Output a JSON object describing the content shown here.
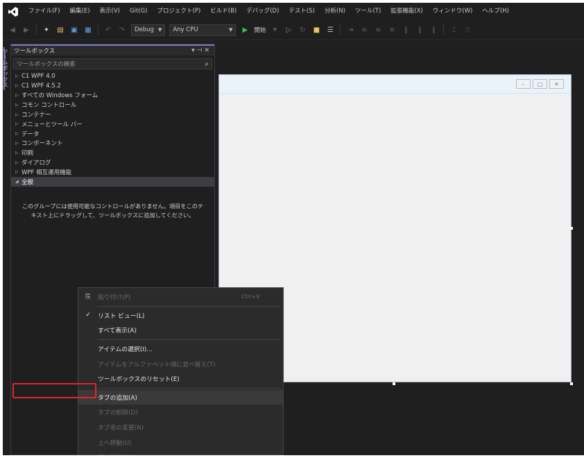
{
  "menubar": {
    "items": [
      "ファイル(F)",
      "編集(E)",
      "表示(V)",
      "Git(G)",
      "プロジェクト(P)",
      "ビルド(B)",
      "デバッグ(D)",
      "テスト(S)",
      "分析(N)",
      "ツール(T)",
      "拡張機能(X)",
      "ウィンドウ(W)",
      "ヘルプ(H)"
    ]
  },
  "toolbar": {
    "config": "Debug",
    "platform": "Any CPU",
    "run_label": "開始"
  },
  "side_tab": {
    "label": "ツールボックス"
  },
  "toolbox": {
    "title": "ツールボックス",
    "search_placeholder": "ツールボックスの検索",
    "groups": [
      {
        "label": "C1 WPF 4.0",
        "expanded": false
      },
      {
        "label": "C1 WPF 4.5.2",
        "expanded": false
      },
      {
        "label": "すべての Windows フォーム",
        "expanded": false
      },
      {
        "label": "コモン コントロール",
        "expanded": false
      },
      {
        "label": "コンテナー",
        "expanded": false
      },
      {
        "label": "メニューとツール バー",
        "expanded": false
      },
      {
        "label": "データ",
        "expanded": false
      },
      {
        "label": "コンポーネント",
        "expanded": false
      },
      {
        "label": "印刷",
        "expanded": false
      },
      {
        "label": "ダイアログ",
        "expanded": false
      },
      {
        "label": "WPF 相互運用機能",
        "expanded": false
      },
      {
        "label": "全般",
        "expanded": true
      }
    ],
    "empty_message": "このグループには使用可能なコントロールがありません。項目をこのテキスト上にドラッグして、ツールボックスに追加してください。"
  },
  "context_menu": {
    "items": [
      {
        "label": "貼り付け(P)",
        "shortcut": "Ctrl+V",
        "disabled": true,
        "checked": false
      },
      {
        "label": "リスト ビュー(L)",
        "shortcut": "",
        "disabled": false,
        "checked": true
      },
      {
        "label": "すべて表示(A)",
        "shortcut": "",
        "disabled": false,
        "checked": false
      },
      {
        "label": "アイテムの選択(I)...",
        "shortcut": "",
        "disabled": false,
        "checked": false
      },
      {
        "label": "アイテムをアルファベット順に並べ替え(T)",
        "shortcut": "",
        "disabled": true,
        "checked": false
      },
      {
        "label": "ツールボックスのリセット(E)",
        "shortcut": "",
        "disabled": false,
        "checked": false
      },
      {
        "label": "タブの追加(A)",
        "shortcut": "",
        "disabled": false,
        "checked": false,
        "highlighted": true
      },
      {
        "label": "タブの削除(D)",
        "shortcut": "",
        "disabled": true,
        "checked": false
      },
      {
        "label": "タブ名の変更(N)",
        "shortcut": "",
        "disabled": true,
        "checked": false
      },
      {
        "label": "上へ移動(U)",
        "shortcut": "",
        "disabled": true,
        "checked": false
      },
      {
        "label": "下へ移動(W)",
        "shortcut": "",
        "disabled": true,
        "checked": false
      }
    ]
  },
  "colors": {
    "highlight_border": "#e8232c",
    "run_green": "#31c651",
    "panel_accent": "#7777cc"
  }
}
